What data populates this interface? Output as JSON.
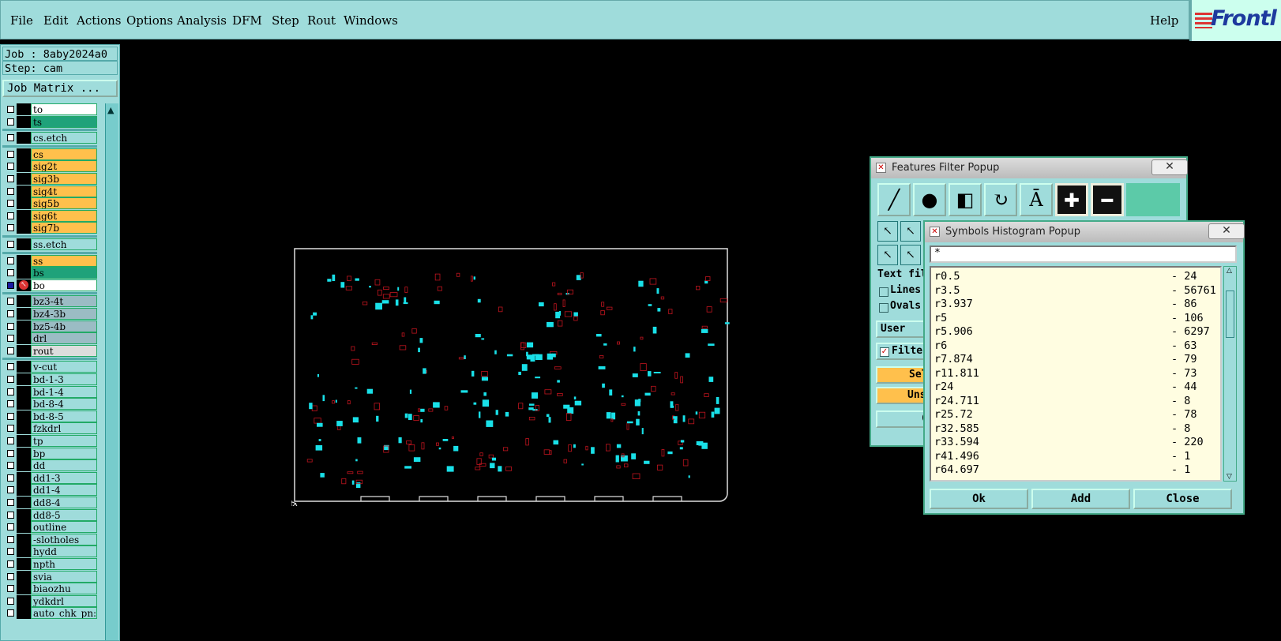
{
  "menu": {
    "items": [
      "File",
      "Edit",
      "Actions",
      "Options",
      "Analysis",
      "DFM",
      "Step",
      "Rout",
      "Windows"
    ],
    "help": "Help",
    "logo": "Frontl"
  },
  "job": {
    "job_label": "Job : 8aby2024a0",
    "step_label": "Step: cam",
    "matrix_button": "Job Matrix ..."
  },
  "layers": [
    {
      "name": "to",
      "color": "#ffffff",
      "group": 1
    },
    {
      "name": "ts",
      "color": "#1fa27a",
      "group": 1
    },
    {
      "name": "cs.etch",
      "color": "#9fdcdb",
      "group": 2
    },
    {
      "name": "cs",
      "color": "#ffc04c",
      "group": 3
    },
    {
      "name": "sig2t",
      "color": "#ffc04c",
      "group": 3
    },
    {
      "name": "sig3b",
      "color": "#ffc04c",
      "group": 3
    },
    {
      "name": "sig4t",
      "color": "#ffc04c",
      "group": 3
    },
    {
      "name": "sig5b",
      "color": "#ffc04c",
      "group": 3
    },
    {
      "name": "sig6t",
      "color": "#ffc04c",
      "group": 3
    },
    {
      "name": "sig7b",
      "color": "#ffc04c",
      "group": 3
    },
    {
      "name": "ss.etch",
      "color": "#9fdcdb",
      "group": 4
    },
    {
      "name": "ss",
      "color": "#ffc04c",
      "group": 5
    },
    {
      "name": "bs",
      "color": "#1fa27a",
      "group": 5
    },
    {
      "name": "bo",
      "color": "#ffffff",
      "group": 5,
      "active": true
    },
    {
      "name": "bz3-4t",
      "color": "#9bbcc4",
      "group": 6
    },
    {
      "name": "bz4-3b",
      "color": "#9bbcc4",
      "group": 6
    },
    {
      "name": "bz5-4b",
      "color": "#9bbcc4",
      "group": 6
    },
    {
      "name": "drl",
      "color": "#9bbcc4",
      "group": 6
    },
    {
      "name": "rout",
      "color": "#dddddd",
      "group": 6
    },
    {
      "name": "v-cut",
      "color": "#9fdcdb",
      "group": 7
    },
    {
      "name": "bd-1-3",
      "color": "#9fdcdb",
      "group": 7
    },
    {
      "name": "bd-1-4",
      "color": "#9fdcdb",
      "group": 7
    },
    {
      "name": "bd-8-4",
      "color": "#9fdcdb",
      "group": 7
    },
    {
      "name": "bd-8-5",
      "color": "#9fdcdb",
      "group": 7
    },
    {
      "name": "fzkdrl",
      "color": "#9fdcdb",
      "group": 7
    },
    {
      "name": "tp",
      "color": "#9fdcdb",
      "group": 7
    },
    {
      "name": "bp",
      "color": "#9fdcdb",
      "group": 7
    },
    {
      "name": "dd",
      "color": "#9fdcdb",
      "group": 7
    },
    {
      "name": "dd1-3",
      "color": "#9fdcdb",
      "group": 7
    },
    {
      "name": "dd1-4",
      "color": "#9fdcdb",
      "group": 7
    },
    {
      "name": "dd8-4",
      "color": "#9fdcdb",
      "group": 7
    },
    {
      "name": "dd8-5",
      "color": "#9fdcdb",
      "group": 7
    },
    {
      "name": "outline",
      "color": "#9fdcdb",
      "group": 7
    },
    {
      "name": "-slotholes",
      "color": "#9fdcdb",
      "group": 7
    },
    {
      "name": "hydd",
      "color": "#9fdcdb",
      "group": 7
    },
    {
      "name": "npth",
      "color": "#9fdcdb",
      "group": 7
    },
    {
      "name": "svia",
      "color": "#9fdcdb",
      "group": 7
    },
    {
      "name": "biaozhu",
      "color": "#9fdcdb",
      "group": 7
    },
    {
      "name": "ydkdrl",
      "color": "#9fdcdb",
      "group": 7
    },
    {
      "name": "auto_chk_pn:",
      "color": "#9fdcdb",
      "group": 7
    }
  ],
  "features_filter": {
    "title": "Features Filter Popup",
    "close": "✕",
    "text_filter_label": "Text fil",
    "lines_label": "Lines",
    "ovals_label": "Ovals",
    "user_filter_label": "User fil",
    "filter_label": "Filter",
    "select_label": "Sel",
    "unselect_label": "Unse",
    "clear_label": "C"
  },
  "symbols_histogram": {
    "title": "Symbols Histogram Popup",
    "close": "✕",
    "filter_value": "*",
    "rows": [
      {
        "symbol": "r0.5",
        "count": "- 24"
      },
      {
        "symbol": "r3.5",
        "count": "- 56761"
      },
      {
        "symbol": "r3.937",
        "count": "- 86"
      },
      {
        "symbol": "r5",
        "count": "- 106"
      },
      {
        "symbol": "r5.906",
        "count": "- 6297"
      },
      {
        "symbol": "r6",
        "count": "- 63"
      },
      {
        "symbol": "r7.874",
        "count": "- 79"
      },
      {
        "symbol": "r11.811",
        "count": "- 73"
      },
      {
        "symbol": "r24",
        "count": "- 44"
      },
      {
        "symbol": "r24.711",
        "count": "- 8"
      },
      {
        "symbol": "r25.72",
        "count": "- 78"
      },
      {
        "symbol": "r32.585",
        "count": "- 8"
      },
      {
        "symbol": "r33.594",
        "count": "- 220"
      },
      {
        "symbol": "r41.496",
        "count": "- 1"
      },
      {
        "symbol": "r64.697",
        "count": "- 1"
      }
    ],
    "ok": "Ok",
    "add": "Add",
    "close_button": "Close"
  },
  "colors": {
    "panel": "#9fdcdb",
    "pad_cyan": "#19e0e8",
    "outline_red": "#c0141e"
  }
}
